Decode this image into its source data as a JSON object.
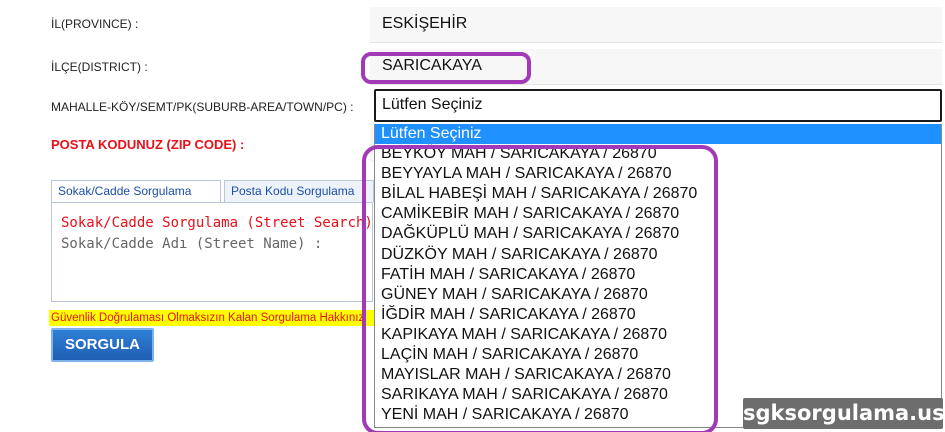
{
  "form": {
    "province_label": "İL(PROVINCE) :",
    "province_value": "ESKİŞEHİR",
    "district_label": "İLÇE(DISTRICT) :",
    "district_value": "SARICAKAYA",
    "suburb_label": "MAHALLE-KÖY/SEMT/PK(SUBURB-AREA/TOWN/PC) :",
    "suburb_selected": "Lütfen Seçiniz",
    "zip_label": "POSTA KODUNUZ (ZIP CODE) :"
  },
  "dropdown": {
    "options": [
      "Lütfen Seçiniz",
      "BEYKÖY MAH / SARICAKAYA / 26870",
      "BEYYAYLA MAH / SARICAKAYA / 26870",
      "BİLAL HABEŞİ MAH / SARICAKAYA / 26870",
      "CAMİKEBİR MAH / SARICAKAYA / 26870",
      "DAĞKÜPLÜ MAH / SARICAKAYA / 26870",
      "DÜZKÖY MAH / SARICAKAYA / 26870",
      "FATİH MAH / SARICAKAYA / 26870",
      "GÜNEY MAH / SARICAKAYA / 26870",
      "İĞDİR MAH / SARICAKAYA / 26870",
      "KAPIKAYA MAH / SARICAKAYA / 26870",
      "LAÇİN MAH / SARICAKAYA / 26870",
      "MAYISLAR MAH / SARICAKAYA / 26870",
      "SARIKAYA MAH / SARICAKAYA / 26870",
      "YENİ MAH / SARICAKAYA / 26870"
    ]
  },
  "tabs": {
    "street": "Sokak/Cadde Sorgulama",
    "postcode": "Posta Kodu Sorgulama"
  },
  "panel": {
    "title": "Sokak/Cadde Sorgulama (Street Search)",
    "street_name_label": "Sokak/Cadde Adı (Street Name) :"
  },
  "warning": "Güvenlik Doğrulaması Olmaksızın Kalan Sorgulama Hakkınız",
  "button": {
    "query": "SORGULA"
  },
  "watermark": "sgksorgulama.us",
  "colors": {
    "highlight": "#a23ab8",
    "selected_option": "#1e90ff",
    "error_text": "#e8101a",
    "button": "#1e5fb3"
  }
}
